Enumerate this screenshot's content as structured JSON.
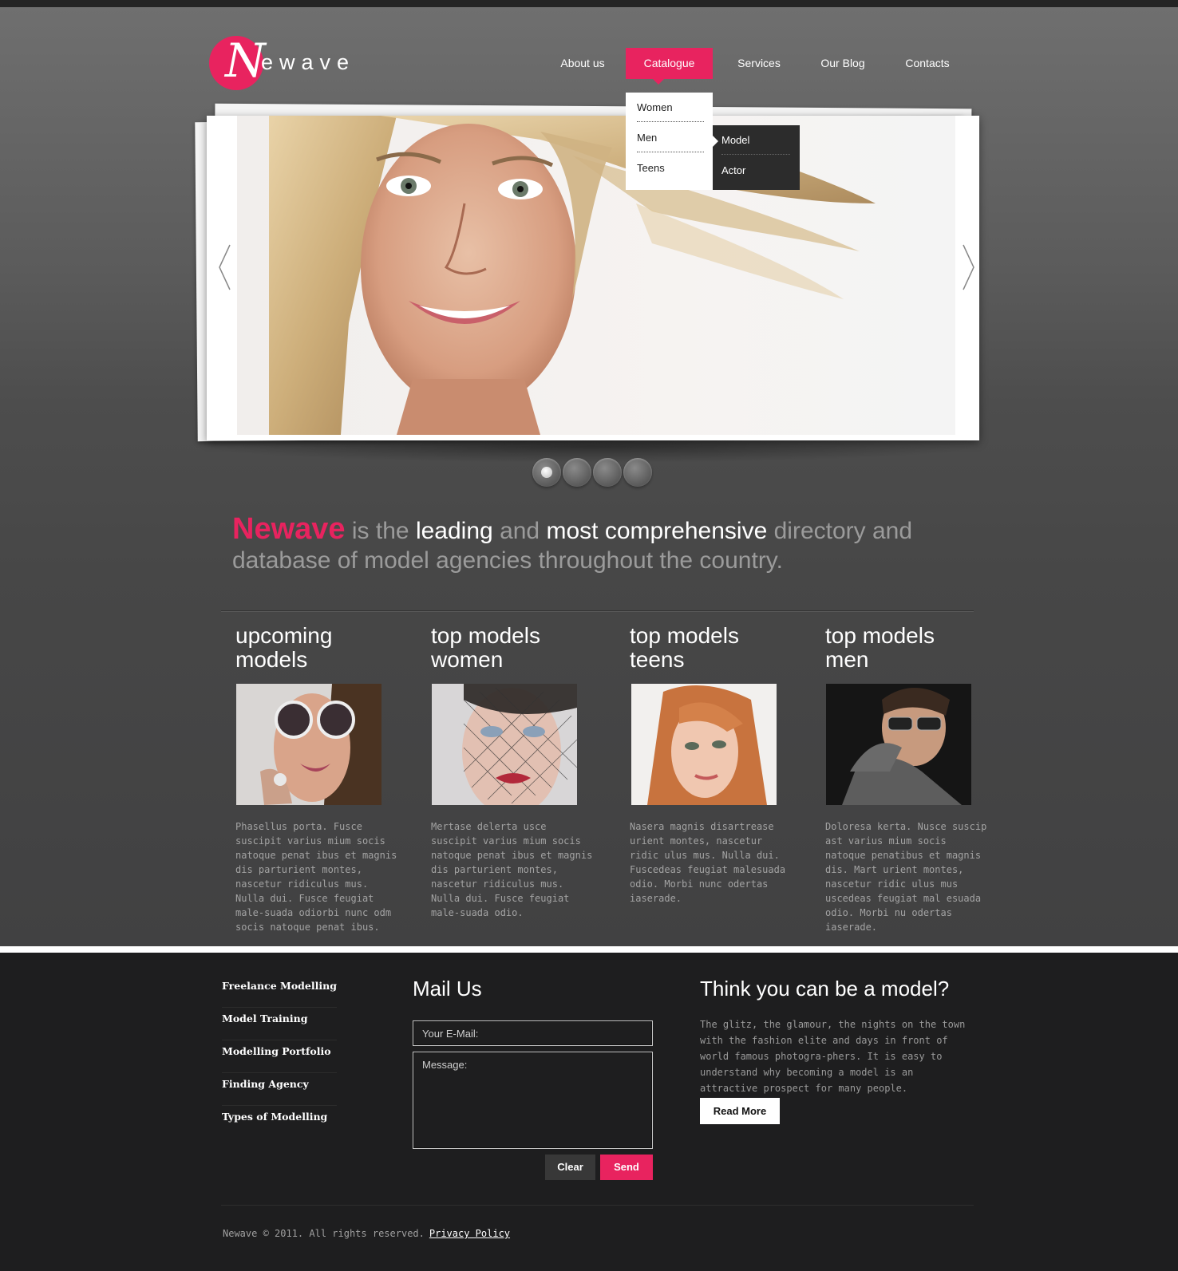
{
  "brand": {
    "logo_initial": "N",
    "logo_rest": "ewave",
    "accent_color": "#e8235f"
  },
  "nav": {
    "items": [
      {
        "label": "About us",
        "active": false
      },
      {
        "label": "Catalogue",
        "active": true
      },
      {
        "label": "Services",
        "active": false
      },
      {
        "label": "Our Blog",
        "active": false
      },
      {
        "label": "Contacts",
        "active": false
      }
    ],
    "dropdown": [
      "Women",
      "Men",
      "Teens"
    ],
    "submenu": [
      "Model",
      "Actor"
    ]
  },
  "slider": {
    "prev_icon": "chevron-left-icon",
    "next_icon": "chevron-right-icon",
    "slide_count": 4,
    "active_slide": 1
  },
  "intro": {
    "brand": "Newave",
    "part1": "is the",
    "hl1": "leading",
    "part2": "and",
    "hl2": "most comprehensive",
    "part3": "directory and database of model agencies throughout the country."
  },
  "columns": [
    {
      "title_line1": "upcoming",
      "title_line2": "models",
      "text": "Phasellus porta. Fusce suscipit varius mium socis natoque penat ibus et magnis dis parturient montes, nascetur ridiculus mus. Nulla dui. Fusce feugiat male-suada odiorbi nunc odm socis natoque penat ibus."
    },
    {
      "title_line1": "top models",
      "title_line2": "women",
      "text": "Mertase delerta usce suscipit varius mium socis natoque penat ibus et magnis dis parturient montes, nascetur ridiculus mus. Nulla dui. Fusce feugiat male-suada odio."
    },
    {
      "title_line1": "top models",
      "title_line2": "teens",
      "text": "Nasera magnis disartrease urient montes, nascetur ridic ulus mus. Nulla dui. Fuscedeas feugiat malesuada odio. Morbi nunc odertas iaserade."
    },
    {
      "title_line1": "top models",
      "title_line2": "men",
      "text": "Doloresa kerta. Nusce suscip ast varius mium socis natoque penatibus et magnis dis. Mart urient montes, nascetur ridic ulus mus uscedeas feugiat mal esuada odio. Morbi nu odertas iaserade."
    }
  ],
  "footer": {
    "links": [
      "Freelance Modelling",
      "Model Training",
      "Modelling Portfolio",
      "Finding Agency",
      "Types of Modelling"
    ],
    "mail": {
      "title": "Mail Us",
      "email_placeholder": "Your E-Mail:",
      "message_placeholder": "Message:",
      "clear_label": "Clear",
      "send_label": "Send"
    },
    "think": {
      "title": "Think you can be a model?",
      "text": "The glitz, the glamour, the nights on the town with the fashion elite and days in front of world famous photogra-phers. It is easy to understand why becoming a model is an attractive prospect for many people.",
      "button_label": "Read More"
    },
    "copyright": "Newave © 2011. All rights reserved.",
    "privacy_label": "Privacy Policy"
  }
}
